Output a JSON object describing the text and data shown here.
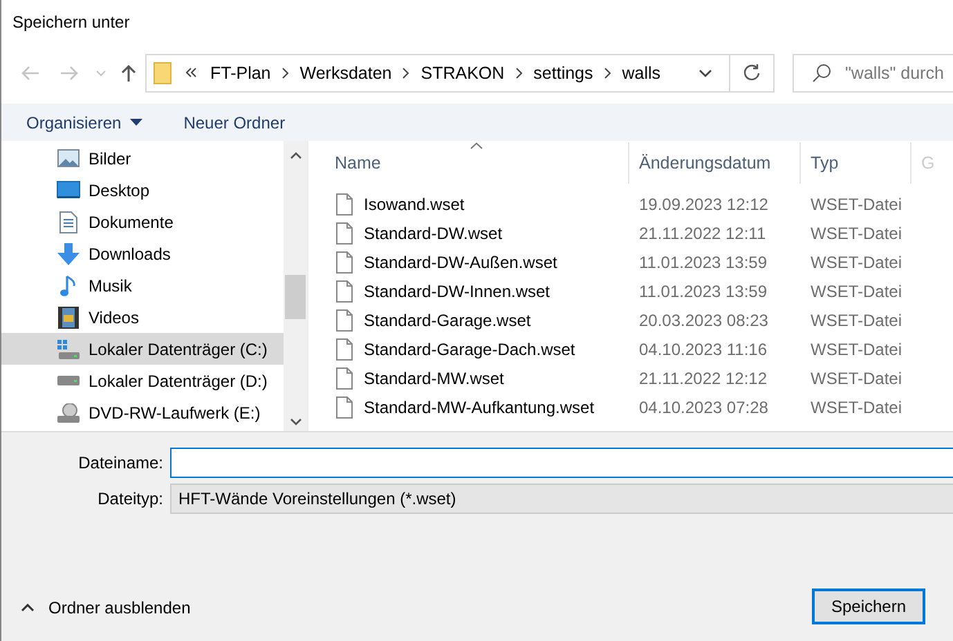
{
  "window": {
    "title": "Speichern unter"
  },
  "breadcrumb": [
    "FT-Plan",
    "Werksdaten",
    "STRAKON",
    "settings",
    "walls"
  ],
  "search": {
    "placeholder": "\"walls\" durch"
  },
  "toolbar": {
    "organize": "Organisieren",
    "new_folder": "Neuer Ordner"
  },
  "sidebar": {
    "items": [
      {
        "label": "Bilder",
        "kind": "pictures",
        "selected": false
      },
      {
        "label": "Desktop",
        "kind": "desktop",
        "selected": false
      },
      {
        "label": "Dokumente",
        "kind": "documents",
        "selected": false
      },
      {
        "label": "Downloads",
        "kind": "downloads",
        "selected": false
      },
      {
        "label": "Musik",
        "kind": "music",
        "selected": false
      },
      {
        "label": "Videos",
        "kind": "videos",
        "selected": false
      },
      {
        "label": "Lokaler Datenträger (C:)",
        "kind": "system-drive",
        "selected": true
      },
      {
        "label": "Lokaler Datenträger (D:)",
        "kind": "drive",
        "selected": false
      },
      {
        "label": "DVD-RW-Laufwerk (E:)",
        "kind": "dvd",
        "selected": false
      }
    ]
  },
  "table": {
    "columns": [
      "Name",
      "Änderungsdatum",
      "Typ",
      "G"
    ],
    "rows": [
      {
        "name": "Isowand.wset",
        "date": "19.09.2023 12:12",
        "type": "WSET-Datei"
      },
      {
        "name": "Standard-DW.wset",
        "date": "21.11.2022 12:11",
        "type": "WSET-Datei"
      },
      {
        "name": "Standard-DW-Außen.wset",
        "date": "11.01.2023 13:59",
        "type": "WSET-Datei"
      },
      {
        "name": "Standard-DW-Innen.wset",
        "date": "11.01.2023 13:59",
        "type": "WSET-Datei"
      },
      {
        "name": "Standard-Garage.wset",
        "date": "20.03.2023 08:23",
        "type": "WSET-Datei"
      },
      {
        "name": "Standard-Garage-Dach.wset",
        "date": "04.10.2023 11:16",
        "type": "WSET-Datei"
      },
      {
        "name": "Standard-MW.wset",
        "date": "21.11.2022 12:12",
        "type": "WSET-Datei"
      },
      {
        "name": "Standard-MW-Aufkantung.wset",
        "date": "04.10.2023 07:28",
        "type": "WSET-Datei"
      }
    ]
  },
  "filename": {
    "label": "Dateiname:"
  },
  "filetype": {
    "label": "Dateityp:",
    "value": "HFT-Wände Voreinstellungen (*.wset)"
  },
  "hide_folders": "Ordner ausblenden",
  "save_button": "Speichern"
}
